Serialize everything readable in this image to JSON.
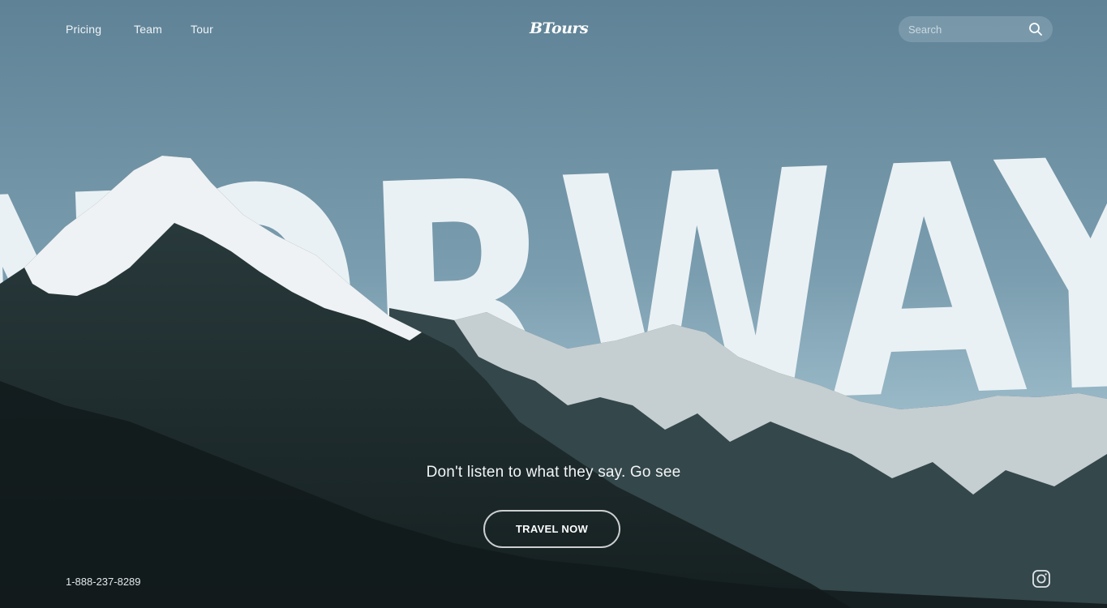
{
  "nav": {
    "links": [
      {
        "label": "Pricing"
      },
      {
        "label": "Team"
      },
      {
        "label": "Tour"
      }
    ]
  },
  "brand": {
    "logo": "BTours"
  },
  "search": {
    "placeholder": "Search",
    "icon": "search-icon"
  },
  "hero": {
    "headline": "NORWAY",
    "tagline": "Don't listen to what they say. Go see",
    "cta_label": "TRAVEL NOW"
  },
  "footer": {
    "phone": "1-888-237-8289",
    "social_icon": "instagram-icon"
  },
  "colors": {
    "sky_top": "#5f8296",
    "sky_bottom": "#a4c3d0",
    "headline": "#eaf1f4",
    "mountain_dark": "#1f2e2f",
    "snow": "#eef2f4"
  }
}
